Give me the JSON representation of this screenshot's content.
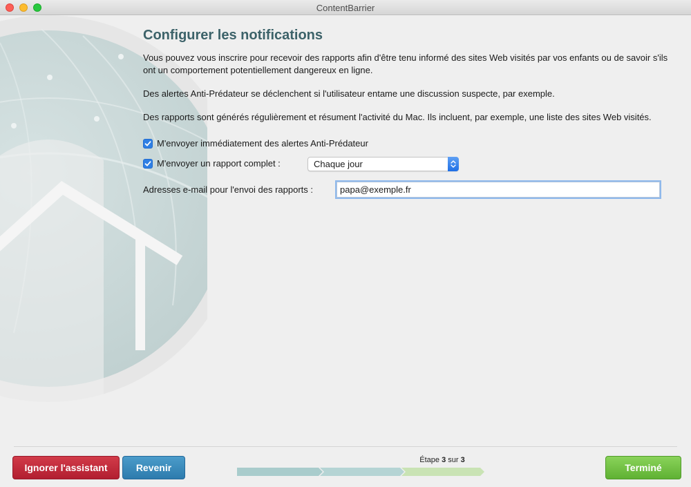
{
  "window": {
    "title": "ContentBarrier"
  },
  "page": {
    "heading": "Configurer les notifications",
    "paragraphs": [
      "Vous pouvez vous inscrire pour recevoir des rapports afin d'être tenu informé des sites Web visités par vos enfants ou de savoir s'ils ont un comportement potentiellement dangereux en ligne.",
      "Des alertes Anti-Prédateur se déclenchent si l'utilisateur entame une discussion suspecte, par exemple.",
      "Des rapports sont générés régulièrement et résument l'activité du Mac. Ils incluent, par exemple, une liste des sites Web visités."
    ]
  },
  "options": {
    "alerts_label": "M'envoyer immédiatement des alertes Anti-Prédateur",
    "alerts_checked": true,
    "report_label": "M'envoyer un rapport complet :",
    "report_checked": true,
    "report_frequency": "Chaque jour"
  },
  "email": {
    "label": "Adresses e-mail pour l'envoi des rapports :",
    "value": "papa@exemple.fr"
  },
  "footer": {
    "skip_label": "Ignorer l'assistant",
    "back_label": "Revenir",
    "done_label": "Terminé",
    "step_prefix": "Étape",
    "step_current": "3",
    "step_sep": "sur",
    "step_total": "3"
  },
  "colors": {
    "heading": "#3c6269",
    "skip": "#c22b3b",
    "back": "#3a8bbd",
    "done": "#74c245",
    "checkbox": "#2f7fe4"
  },
  "icons": {
    "checkbox": "checkmark-icon",
    "select": "updown-chevron-icon",
    "decoration": "house-globe-logo"
  }
}
